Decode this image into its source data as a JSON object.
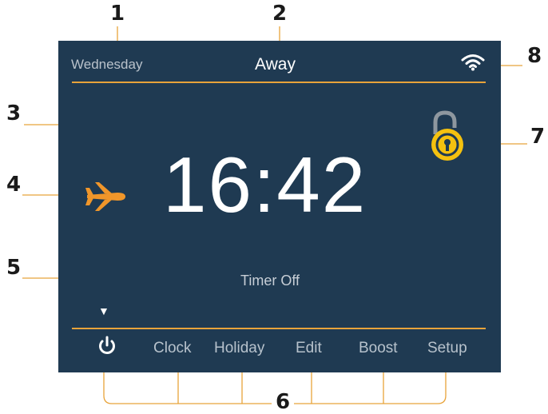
{
  "callouts": {
    "n1": "1",
    "n2": "2",
    "n3": "3",
    "n4": "4",
    "n5": "5",
    "n6": "6",
    "n7": "7",
    "n8": "8"
  },
  "screen": {
    "day": "Wednesday",
    "mode": "Away",
    "time": "16:42",
    "timer_status": "Timer Off",
    "menu_indicator": "▼",
    "softkeys": {
      "power_icon": "power-icon",
      "clock": "Clock",
      "holiday": "Holiday",
      "edit": "Edit",
      "boost": "Boost",
      "setup": "Setup"
    }
  },
  "icons": {
    "wifi": "wifi-icon",
    "away_mode": "airplane-icon",
    "lock": "padlock-unlocked-icon"
  },
  "colors": {
    "screen_bg": "#1f3a52",
    "accent": "#e8a33a",
    "lock_yellow": "#f4c10f"
  }
}
